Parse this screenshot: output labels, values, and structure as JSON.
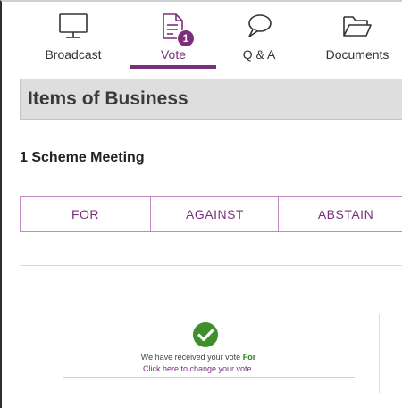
{
  "tabs": [
    {
      "label": "Broadcast",
      "icon": "monitor-icon"
    },
    {
      "label": "Vote",
      "icon": "document-icon",
      "badge": "1",
      "active": true
    },
    {
      "label": "Q & A",
      "icon": "speech-bubble-icon"
    },
    {
      "label": "Documents",
      "icon": "folder-icon"
    }
  ],
  "section": {
    "title": "Items of Business"
  },
  "resolution": {
    "title": "1 Scheme Meeting"
  },
  "vote_options": [
    "FOR",
    "AGAINST",
    "ABSTAIN"
  ],
  "confirmation": {
    "received_text": "We have received your vote",
    "vote_value": "For",
    "change_link": "Click here to change your vote."
  },
  "colors": {
    "accent": "#7b2f7b",
    "success": "#2e7d1f"
  }
}
